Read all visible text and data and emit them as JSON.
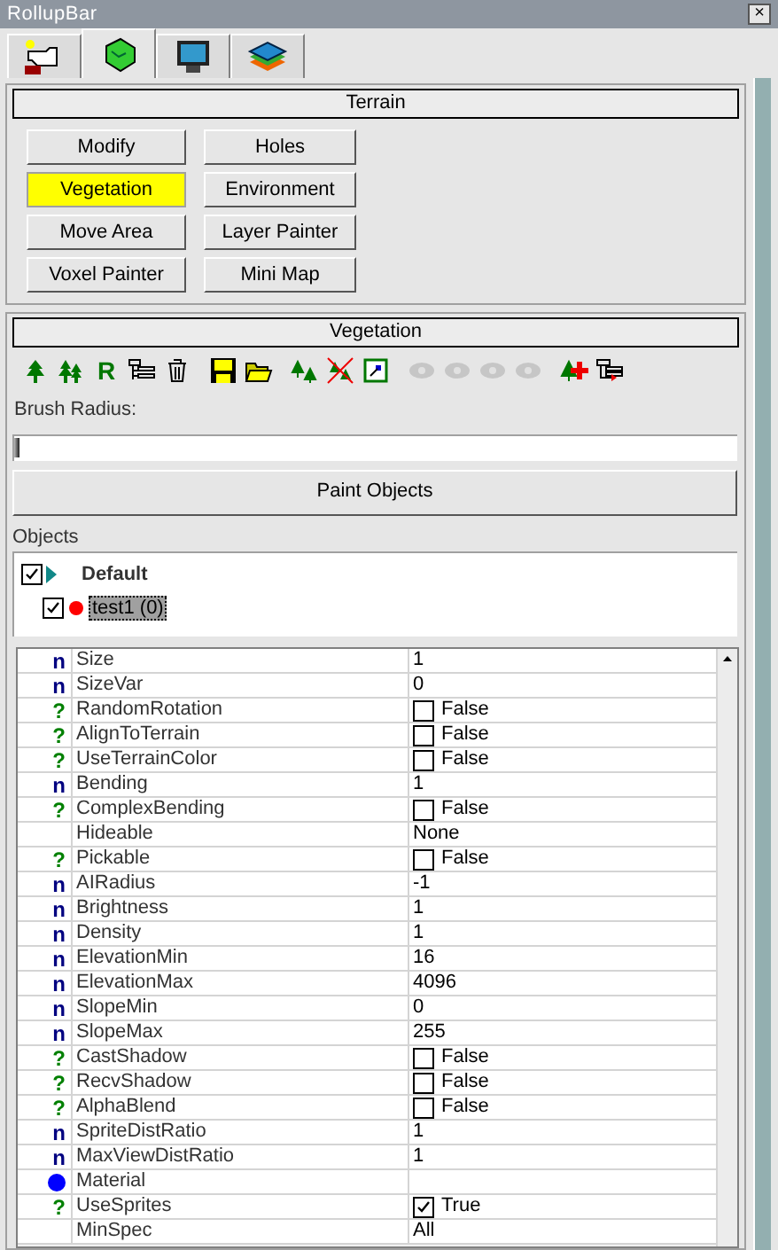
{
  "window": {
    "title": "RollupBar",
    "close": "×"
  },
  "tabs": [
    {
      "kind": "new",
      "selected": false
    },
    {
      "kind": "terrain",
      "selected": true
    },
    {
      "kind": "display",
      "selected": false
    },
    {
      "kind": "layers",
      "selected": false
    }
  ],
  "terrain_panel": {
    "title": "Terrain",
    "buttons": [
      {
        "label": "Modify",
        "selected": false
      },
      {
        "label": "Holes",
        "selected": false
      },
      {
        "label": "Vegetation",
        "selected": true
      },
      {
        "label": "Environment",
        "selected": false
      },
      {
        "label": "Move Area",
        "selected": false
      },
      {
        "label": "Layer Painter",
        "selected": false
      },
      {
        "label": "Voxel Painter",
        "selected": false
      },
      {
        "label": "Mini Map",
        "selected": false
      }
    ]
  },
  "vegetation_panel": {
    "title": "Vegetation",
    "toolbar": [
      {
        "kind": "tree",
        "disabled": false
      },
      {
        "kind": "trees",
        "disabled": false
      },
      {
        "kind": "r",
        "label": "R",
        "disabled": false
      },
      {
        "kind": "add-list",
        "disabled": false
      },
      {
        "kind": "trash",
        "disabled": false
      },
      {
        "kind": "save",
        "disabled": false
      },
      {
        "kind": "open",
        "disabled": false
      },
      {
        "kind": "small-trees",
        "disabled": false
      },
      {
        "kind": "cross-trees",
        "disabled": false
      },
      {
        "kind": "frame",
        "disabled": false
      },
      {
        "kind": "eye",
        "disabled": true
      },
      {
        "kind": "eye",
        "disabled": true
      },
      {
        "kind": "eye",
        "disabled": true
      },
      {
        "kind": "eye",
        "disabled": true
      },
      {
        "kind": "add-tree",
        "disabled": false
      },
      {
        "kind": "move-list",
        "disabled": false
      }
    ],
    "brush_label": "Brush Radius:",
    "brush": {
      "level": 0.0
    },
    "paint_button": "Paint Objects",
    "objects_label": "Objects",
    "objects": [
      {
        "label": "Default",
        "checked": true,
        "expanded": true,
        "children": [
          {
            "label": "test1 (0)",
            "checked": true,
            "selected": true,
            "color": "#ff0000"
          }
        ]
      }
    ]
  },
  "properties": [
    {
      "kind": "number",
      "icon": "n",
      "name": "Size",
      "value": "1"
    },
    {
      "kind": "number",
      "icon": "n",
      "name": "SizeVar",
      "value": "0"
    },
    {
      "kind": "bool",
      "icon": "?",
      "name": "RandomRotation",
      "value": "False",
      "checked": false
    },
    {
      "kind": "bool",
      "icon": "?",
      "name": "AlignToTerrain",
      "value": "False",
      "checked": false
    },
    {
      "kind": "bool",
      "icon": "?",
      "name": "UseTerrainColor",
      "value": "False",
      "checked": false
    },
    {
      "kind": "number",
      "icon": "n",
      "name": "Bending",
      "value": "1"
    },
    {
      "kind": "bool",
      "icon": "?",
      "name": "ComplexBending",
      "value": "False",
      "checked": false
    },
    {
      "kind": "plain",
      "name": "Hideable",
      "value": "None"
    },
    {
      "kind": "bool",
      "icon": "?",
      "name": "Pickable",
      "value": "False",
      "checked": false
    },
    {
      "kind": "number",
      "icon": "n",
      "name": "AIRadius",
      "value": "-1"
    },
    {
      "kind": "number",
      "icon": "n",
      "name": "Brightness",
      "value": "1"
    },
    {
      "kind": "number",
      "icon": "n",
      "name": "Density",
      "value": "1"
    },
    {
      "kind": "number",
      "icon": "n",
      "name": "ElevationMin",
      "value": "16"
    },
    {
      "kind": "number",
      "icon": "n",
      "name": "ElevationMax",
      "value": "4096"
    },
    {
      "kind": "number",
      "icon": "n",
      "name": "SlopeMin",
      "value": "0"
    },
    {
      "kind": "number",
      "icon": "n",
      "name": "SlopeMax",
      "value": "255"
    },
    {
      "kind": "bool",
      "icon": "?",
      "name": "CastShadow",
      "value": "False",
      "checked": false
    },
    {
      "kind": "bool",
      "icon": "?",
      "name": "RecvShadow",
      "value": "False",
      "checked": false
    },
    {
      "kind": "bool",
      "icon": "?",
      "name": "AlphaBlend",
      "value": "False",
      "checked": false
    },
    {
      "kind": "number",
      "icon": "n",
      "name": "SpriteDistRatio",
      "value": "1"
    },
    {
      "kind": "number",
      "icon": "n",
      "name": "MaxViewDistRatio",
      "value": "1"
    },
    {
      "kind": "material",
      "name": "Material"
    },
    {
      "kind": "bool",
      "icon": "?",
      "name": "UseSprites",
      "value": "True",
      "checked": true
    },
    {
      "kind": "plain",
      "name": "MinSpec",
      "value": "All"
    }
  ]
}
